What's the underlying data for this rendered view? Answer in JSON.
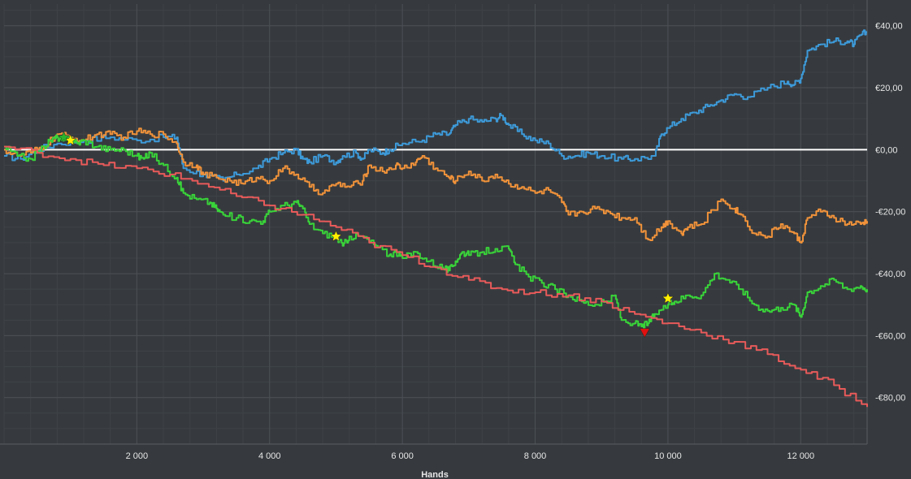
{
  "chart_data": {
    "type": "line",
    "xlabel": "Hands",
    "ylabel": "",
    "xlim": [
      0,
      13000
    ],
    "ylim": [
      -95,
      47
    ],
    "x_ticks": [
      2000,
      4000,
      6000,
      8000,
      10000,
      12000
    ],
    "x_tick_labels": [
      "2 000",
      "4 000",
      "6 000",
      "8 000",
      "10 000",
      "12 000"
    ],
    "y_ticks": [
      40,
      20,
      0,
      -20,
      -40,
      -60,
      -80
    ],
    "y_tick_labels": [
      "€40,00",
      "€20,00",
      "€0,00",
      "-€20,00",
      "-€40,00",
      "-€60,00",
      "-€80,00"
    ],
    "grid": true,
    "zero_line": 0,
    "colors": {
      "background": "#363a3e",
      "grid_major": "#4c5055",
      "grid_minor": "#3f4347",
      "zero_line": "#ffffff",
      "axis_text": "#e6e6e6"
    },
    "series": [
      {
        "color": "#3d9ad9",
        "points": [
          [
            0,
            -2
          ],
          [
            250,
            -3
          ],
          [
            500,
            0
          ],
          [
            800,
            2
          ],
          [
            1200,
            3
          ],
          [
            1600,
            4
          ],
          [
            2000,
            3
          ],
          [
            2400,
            4
          ],
          [
            2600,
            4
          ],
          [
            2700,
            -6
          ],
          [
            3000,
            -8
          ],
          [
            3300,
            -10
          ],
          [
            3500,
            -8
          ],
          [
            3800,
            -6
          ],
          [
            4000,
            -3
          ],
          [
            4200,
            -1
          ],
          [
            4400,
            0
          ],
          [
            4500,
            -3
          ],
          [
            4600,
            -4
          ],
          [
            4800,
            -2
          ],
          [
            5000,
            -4
          ],
          [
            5100,
            -2
          ],
          [
            5300,
            -1
          ],
          [
            5400,
            -3
          ],
          [
            5500,
            0
          ],
          [
            5700,
            -1
          ],
          [
            5800,
            0
          ],
          [
            6000,
            2
          ],
          [
            6300,
            3
          ],
          [
            6500,
            5
          ],
          [
            6700,
            5
          ],
          [
            6800,
            8
          ],
          [
            7000,
            10
          ],
          [
            7200,
            9
          ],
          [
            7400,
            10
          ],
          [
            7500,
            11
          ],
          [
            7600,
            8
          ],
          [
            7800,
            5
          ],
          [
            8000,
            3
          ],
          [
            8200,
            2
          ],
          [
            8400,
            -2
          ],
          [
            8600,
            -2
          ],
          [
            8800,
            -1
          ],
          [
            9000,
            -2
          ],
          [
            9300,
            -3
          ],
          [
            9500,
            -3
          ],
          [
            9800,
            -2
          ],
          [
            9900,
            5
          ],
          [
            10000,
            7
          ],
          [
            10200,
            10
          ],
          [
            10400,
            12
          ],
          [
            10600,
            14
          ],
          [
            10800,
            16
          ],
          [
            11000,
            18
          ],
          [
            11200,
            17
          ],
          [
            11500,
            20
          ],
          [
            11800,
            22
          ],
          [
            11900,
            21
          ],
          [
            12000,
            23
          ],
          [
            12100,
            32
          ],
          [
            12300,
            34
          ],
          [
            12500,
            35
          ],
          [
            12700,
            35
          ],
          [
            12800,
            34
          ],
          [
            12900,
            37
          ],
          [
            13000,
            38
          ]
        ]
      },
      {
        "color": "#f0923a",
        "points": [
          [
            0,
            0
          ],
          [
            200,
            -2
          ],
          [
            400,
            -1
          ],
          [
            600,
            1
          ],
          [
            800,
            5
          ],
          [
            1000,
            4
          ],
          [
            1200,
            3
          ],
          [
            1400,
            5
          ],
          [
            1600,
            5
          ],
          [
            1800,
            4
          ],
          [
            2000,
            6
          ],
          [
            2200,
            5
          ],
          [
            2400,
            5
          ],
          [
            2600,
            2
          ],
          [
            2700,
            -4
          ],
          [
            2900,
            -5
          ],
          [
            3000,
            -8
          ],
          [
            3200,
            -9
          ],
          [
            3400,
            -10
          ],
          [
            3600,
            -11
          ],
          [
            3800,
            -9
          ],
          [
            4000,
            -10
          ],
          [
            4200,
            -6
          ],
          [
            4400,
            -8
          ],
          [
            4600,
            -12
          ],
          [
            4800,
            -14
          ],
          [
            5000,
            -11
          ],
          [
            5200,
            -12
          ],
          [
            5400,
            -10
          ],
          [
            5500,
            -5
          ],
          [
            5700,
            -7
          ],
          [
            5900,
            -5
          ],
          [
            6000,
            -6
          ],
          [
            6200,
            -4
          ],
          [
            6300,
            -2
          ],
          [
            6500,
            -6
          ],
          [
            6700,
            -9
          ],
          [
            6800,
            -10
          ],
          [
            7000,
            -7
          ],
          [
            7200,
            -10
          ],
          [
            7400,
            -8
          ],
          [
            7600,
            -11
          ],
          [
            7800,
            -12
          ],
          [
            8000,
            -14
          ],
          [
            8200,
            -13
          ],
          [
            8400,
            -17
          ],
          [
            8500,
            -21
          ],
          [
            8700,
            -20
          ],
          [
            8900,
            -19
          ],
          [
            9100,
            -20
          ],
          [
            9300,
            -22
          ],
          [
            9500,
            -22
          ],
          [
            9700,
            -29
          ],
          [
            9900,
            -25
          ],
          [
            10000,
            -23
          ],
          [
            10200,
            -27
          ],
          [
            10300,
            -25
          ],
          [
            10500,
            -24
          ],
          [
            10800,
            -16
          ],
          [
            11000,
            -19
          ],
          [
            11100,
            -21
          ],
          [
            11300,
            -27
          ],
          [
            11500,
            -28
          ],
          [
            11700,
            -24
          ],
          [
            11900,
            -27
          ],
          [
            12000,
            -30
          ],
          [
            12100,
            -22
          ],
          [
            12300,
            -20
          ],
          [
            12500,
            -22
          ],
          [
            12700,
            -24
          ],
          [
            12900,
            -24
          ],
          [
            13000,
            -23
          ]
        ]
      },
      {
        "color": "#39d339",
        "points": [
          [
            0,
            1
          ],
          [
            200,
            -2
          ],
          [
            400,
            -3
          ],
          [
            600,
            1
          ],
          [
            700,
            3
          ],
          [
            800,
            4
          ],
          [
            900,
            3
          ],
          [
            1000,
            4
          ],
          [
            1100,
            2
          ],
          [
            1200,
            3
          ],
          [
            1400,
            1
          ],
          [
            1600,
            0
          ],
          [
            1800,
            0
          ],
          [
            2000,
            -2
          ],
          [
            2100,
            -3
          ],
          [
            2200,
            -1
          ],
          [
            2400,
            -5
          ],
          [
            2600,
            -9
          ],
          [
            2700,
            -14
          ],
          [
            2900,
            -16
          ],
          [
            3100,
            -17
          ],
          [
            3200,
            -19
          ],
          [
            3300,
            -21
          ],
          [
            3500,
            -22
          ],
          [
            3700,
            -23
          ],
          [
            3900,
            -23
          ],
          [
            4000,
            -20
          ],
          [
            4200,
            -18
          ],
          [
            4400,
            -17
          ],
          [
            4500,
            -19
          ],
          [
            4600,
            -24
          ],
          [
            4800,
            -27
          ],
          [
            5000,
            -28
          ],
          [
            5100,
            -31
          ],
          [
            5200,
            -28
          ],
          [
            5400,
            -28
          ],
          [
            5600,
            -31
          ],
          [
            5800,
            -34
          ],
          [
            5900,
            -33
          ],
          [
            6000,
            -35
          ],
          [
            6200,
            -33
          ],
          [
            6400,
            -36
          ],
          [
            6600,
            -38
          ],
          [
            6700,
            -39
          ],
          [
            6800,
            -36
          ],
          [
            6900,
            -33
          ],
          [
            7000,
            -34
          ],
          [
            7200,
            -33
          ],
          [
            7400,
            -32
          ],
          [
            7600,
            -32
          ],
          [
            7700,
            -37
          ],
          [
            7900,
            -41
          ],
          [
            8100,
            -43
          ],
          [
            8300,
            -45
          ],
          [
            8500,
            -47
          ],
          [
            8700,
            -49
          ],
          [
            8900,
            -50
          ],
          [
            9100,
            -49
          ],
          [
            9200,
            -47
          ],
          [
            9300,
            -55
          ],
          [
            9500,
            -56
          ],
          [
            9600,
            -57
          ],
          [
            9700,
            -56
          ],
          [
            9800,
            -53
          ],
          [
            10000,
            -50
          ],
          [
            10100,
            -49
          ],
          [
            10300,
            -47
          ],
          [
            10500,
            -47
          ],
          [
            10700,
            -40
          ],
          [
            10900,
            -42
          ],
          [
            11100,
            -45
          ],
          [
            11300,
            -50
          ],
          [
            11500,
            -52
          ],
          [
            11700,
            -51
          ],
          [
            11900,
            -50
          ],
          [
            12000,
            -54
          ],
          [
            12100,
            -46
          ],
          [
            12300,
            -44
          ],
          [
            12500,
            -42
          ],
          [
            12700,
            -45
          ],
          [
            12900,
            -44
          ],
          [
            13000,
            -45
          ]
        ]
      },
      {
        "color": "#e85a5a",
        "points": [
          [
            0,
            1
          ],
          [
            500,
            -1
          ],
          [
            1000,
            -3
          ],
          [
            1500,
            -5
          ],
          [
            2000,
            -6
          ],
          [
            2500,
            -8
          ],
          [
            3000,
            -11
          ],
          [
            3500,
            -15
          ],
          [
            4000,
            -18
          ],
          [
            4500,
            -21
          ],
          [
            5000,
            -25
          ],
          [
            5500,
            -30
          ],
          [
            6000,
            -34
          ],
          [
            6500,
            -38
          ],
          [
            7000,
            -42
          ],
          [
            7500,
            -45
          ],
          [
            8000,
            -46
          ],
          [
            8500,
            -47
          ],
          [
            9000,
            -49
          ],
          [
            9500,
            -53
          ],
          [
            10000,
            -56
          ],
          [
            10500,
            -59
          ],
          [
            11000,
            -62
          ],
          [
            11500,
            -66
          ],
          [
            12000,
            -71
          ],
          [
            12500,
            -76
          ],
          [
            13000,
            -83
          ]
        ]
      }
    ],
    "markers": [
      {
        "type": "star",
        "color": "#ffee00",
        "x": 1000,
        "y": 3
      },
      {
        "type": "star",
        "color": "#2bb52b",
        "x": 900,
        "y": 4
      },
      {
        "type": "star",
        "color": "#ffee00",
        "x": 5000,
        "y": -28
      },
      {
        "type": "star",
        "color": "#ffee00",
        "x": 10000,
        "y": -48
      },
      {
        "type": "triangle-down",
        "color": "#e01010",
        "x": 9650,
        "y": -59
      }
    ]
  }
}
